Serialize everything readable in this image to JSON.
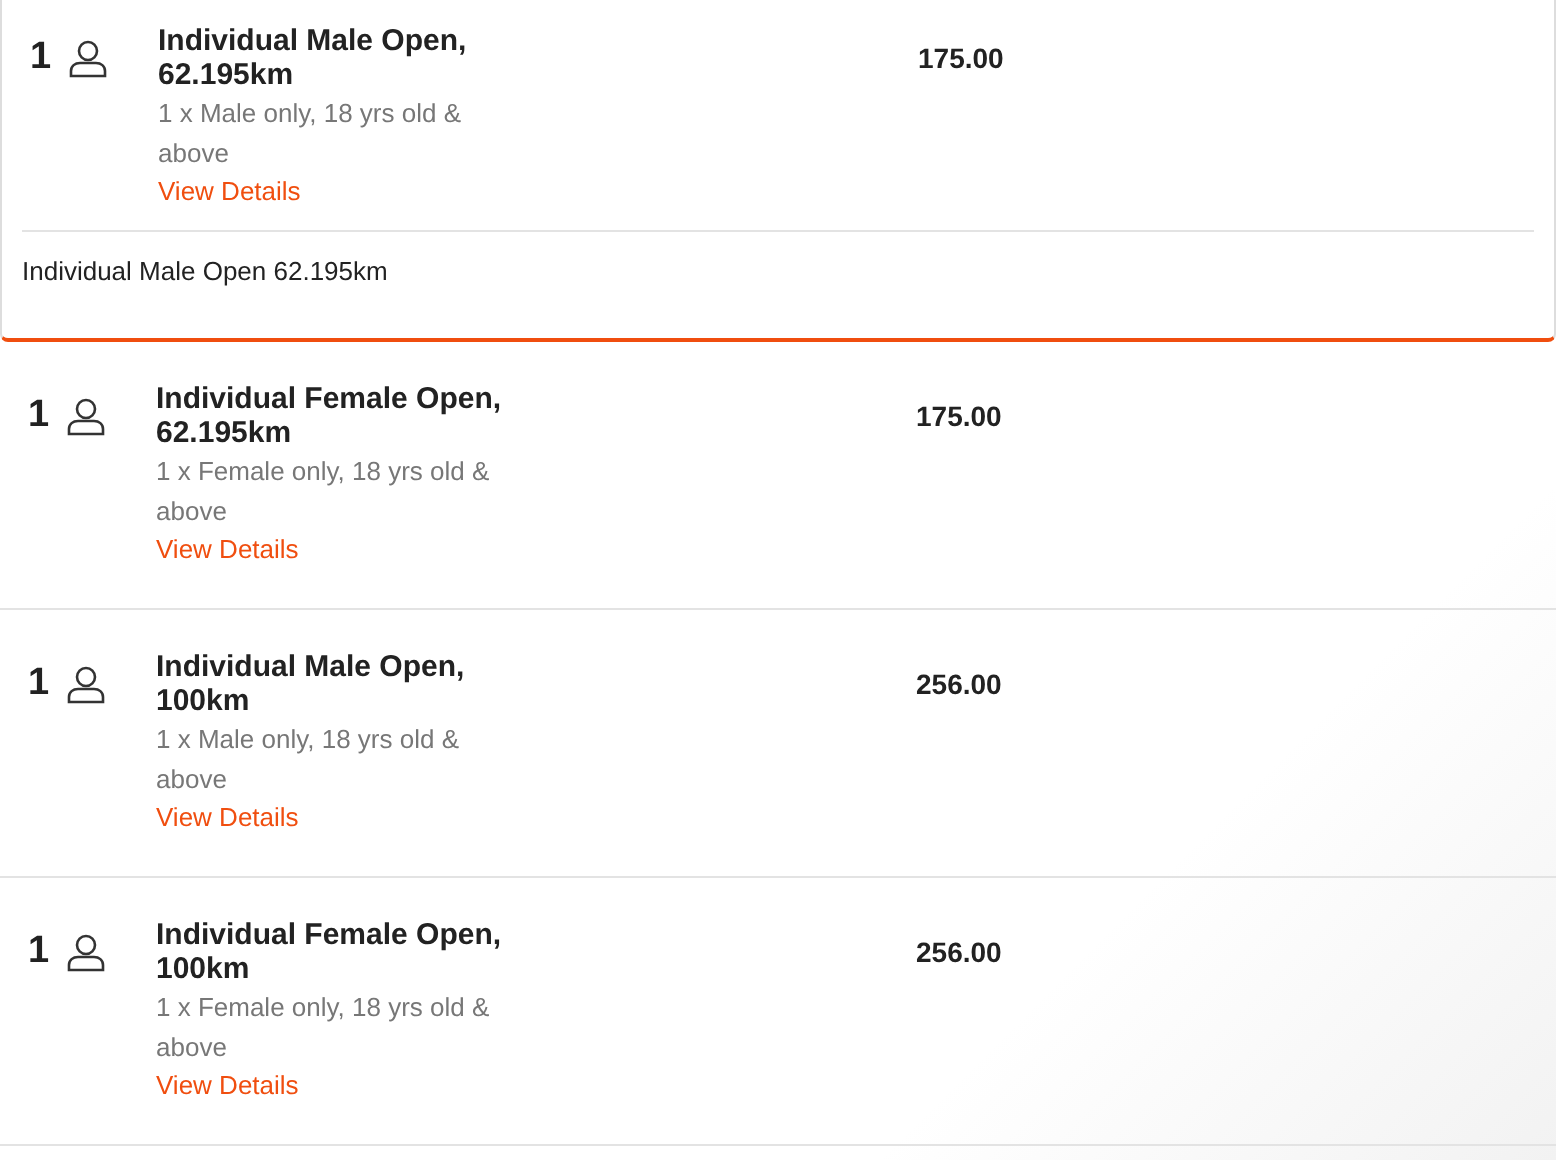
{
  "tickets": [
    {
      "quantity": "1",
      "title": "Individual Male Open, 62.195km",
      "description": "1 x Male only, 18 yrs old & above",
      "link": "View Details",
      "price": "175.00",
      "expanded": true,
      "details": "Individual Male Open 62.195km"
    },
    {
      "quantity": "1",
      "title": "Individual Female Open, 62.195km",
      "description": "1 x Female only, 18 yrs old & above",
      "link": "View Details",
      "price": "175.00",
      "expanded": false
    },
    {
      "quantity": "1",
      "title": "Individual Male Open, 100km",
      "description": "1 x Male only, 18 yrs old & above",
      "link": "View Details",
      "price": "256.00",
      "expanded": false
    },
    {
      "quantity": "1",
      "title": "Individual Female Open, 100km",
      "description": "1 x Female only, 18 yrs old & above",
      "link": "View Details",
      "price": "256.00",
      "expanded": false
    }
  ]
}
